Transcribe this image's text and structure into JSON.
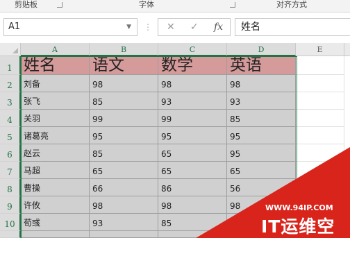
{
  "ribbon": {
    "groups": [
      "剪贴板",
      "字体",
      "对齐方式"
    ]
  },
  "formula_bar": {
    "name_box": "A1",
    "cancel_glyph": "✕",
    "enter_glyph": "✓",
    "fx_glyph": "fx",
    "content": "姓名"
  },
  "columns": [
    "A",
    "B",
    "C",
    "D",
    "E"
  ],
  "rows": [
    "1",
    "2",
    "3",
    "4",
    "5",
    "6",
    "7",
    "8",
    "9",
    "10"
  ],
  "table": {
    "header": [
      "姓名",
      "语文",
      "数学",
      "英语"
    ],
    "data": [
      [
        "刘备",
        "98",
        "98",
        "98"
      ],
      [
        "张飞",
        "85",
        "93",
        "93"
      ],
      [
        "关羽",
        "99",
        "99",
        "85"
      ],
      [
        "诸葛亮",
        "95",
        "95",
        "95"
      ],
      [
        "赵云",
        "85",
        "65",
        "95"
      ],
      [
        "马超",
        "65",
        "65",
        "65"
      ],
      [
        "曹操",
        "66",
        "86",
        "56"
      ],
      [
        "许攸",
        "98",
        "98",
        "98"
      ],
      [
        "荀彧",
        "93",
        "85",
        ""
      ]
    ]
  },
  "watermark": {
    "url": "WWW.94IP.COM",
    "name": "IT运维空间"
  },
  "colors": {
    "header_fill": "#d59a9a",
    "body_fill": "#d0d0d0",
    "selection": "#217346",
    "watermark": "#d9241c"
  }
}
